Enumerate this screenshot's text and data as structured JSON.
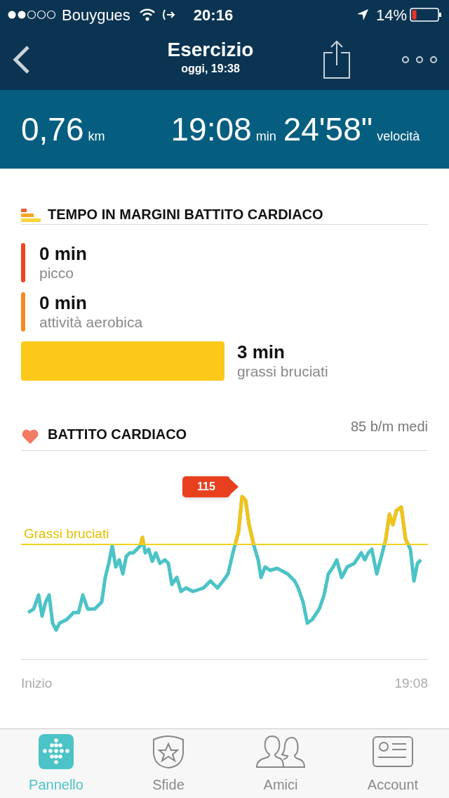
{
  "status_bar": {
    "carrier": "Bouygues",
    "time": "20:16",
    "battery": "14%"
  },
  "nav": {
    "title": "Esercizio",
    "subtitle": "oggi, 19:38"
  },
  "stats": [
    {
      "value": "0,76",
      "unit": "km"
    },
    {
      "value": "19:08",
      "unit": "min"
    },
    {
      "value": "24'58\"",
      "unit": "velocità"
    }
  ],
  "zones_section": {
    "title": "TEMPO IN MARGINI BATTITO CARDIACO",
    "zones": [
      {
        "value": "0 min",
        "label": "picco",
        "color": "#f0441e",
        "kind": "marker"
      },
      {
        "value": "0 min",
        "label": "attività aerobica",
        "color": "#f58b1f",
        "kind": "marker"
      },
      {
        "value": "3 min",
        "label": "grassi bruciati",
        "color": "#fcc91a",
        "kind": "bar"
      }
    ]
  },
  "heart_section": {
    "title": "BATTITO CARDIACO",
    "average": "85 b/m medi",
    "peak_badge": "115",
    "threshold_label": "Grassi bruciati",
    "start_label": "Inizio",
    "end_label": "19:08"
  },
  "tabs": [
    {
      "label": "Pannello",
      "selected": true
    },
    {
      "label": "Sfide",
      "selected": false
    },
    {
      "label": "Amici",
      "selected": false
    },
    {
      "label": "Account",
      "selected": false
    }
  ]
}
